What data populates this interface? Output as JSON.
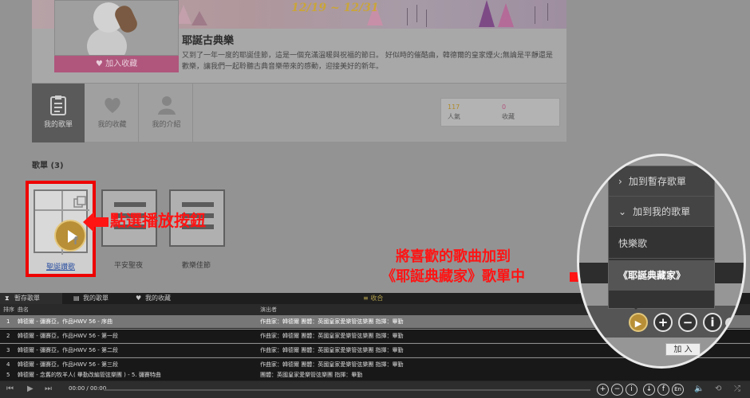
{
  "album": {
    "date_range": "12/19 ~ 12/31",
    "title": "耶誕古典樂",
    "description": "又到了一年一度的耶誕佳節，這是一個充滿溫暖與祝福的節日。 好似時的催酷曲，韓德爾的皇家煙火;無論是平靜還是歡樂，讓我們一起聆聽古典音樂帶來的感動，迎接美好的新年。",
    "fav_button": "加入收藏"
  },
  "tabs": [
    {
      "label": "我的歌單",
      "icon": "clipboard-icon"
    },
    {
      "label": "我的收藏",
      "icon": "heart-icon"
    },
    {
      "label": "我的介紹",
      "icon": "user-icon"
    }
  ],
  "stats": {
    "popularity_value": "117",
    "popularity_label": "人氣",
    "collect_value": "0",
    "collect_label": "收藏"
  },
  "playlists": {
    "section_title": "歌單 (3)",
    "items": [
      {
        "label": "聖誕讚歌"
      },
      {
        "label": "平安聖夜"
      },
      {
        "label": "歡樂佳節"
      }
    ]
  },
  "annotations": {
    "click_play": "點選播放按鈕",
    "add_line1": "將喜歡的歌曲加到",
    "add_line2": "《耶誕典藏家》歌單中"
  },
  "player": {
    "tabs": [
      "暫存歌單",
      "我的歌單",
      "我的收藏"
    ],
    "collapse": "≡ 收合",
    "headers": {
      "index": "排序",
      "name": "曲名",
      "performer": "演出者"
    },
    "rows": [
      {
        "index": "1",
        "name": "韓德爾 - 彌賽亞，作品HWV 56 - 序曲",
        "performer": "作曲家：韓德爾 團體：英國皇家愛樂管弦樂團 指揮：畢勤"
      },
      {
        "index": "2",
        "name": "韓德爾 - 彌賽亞，作品HWV 56 - 第一段",
        "performer": "作曲家：韓德爾 團體：英國皇家愛樂管弦樂團 指揮：畢勤"
      },
      {
        "index": "3",
        "name": "韓德爾 - 彌賽亞，作品HWV 56 - 第二段",
        "performer": "作曲家：韓德爾 團體：英國皇家愛樂管弦樂團 指揮：畢勤"
      },
      {
        "index": "4",
        "name": "韓德爾 - 彌賽亞，作品HWV 56 - 第三段",
        "performer": "作曲家：韓德爾 團體：英國皇家愛樂管弦樂團 指揮：畢勤"
      },
      {
        "index": "5",
        "name": "韓德爾 - 念舊的牧羊人( 畢勤改編管弦樂團 ) - 5. 彌賽特曲",
        "performer": "團體：英國皇家愛樂管弦樂團 指揮：畢勤"
      }
    ],
    "time": "00:00 / 00:00"
  },
  "menu": {
    "items": [
      "加到暫存歌單",
      "加到我的歌單",
      "快樂歌",
      "《耶誕典藏家》"
    ],
    "tooltip": "加 入"
  }
}
